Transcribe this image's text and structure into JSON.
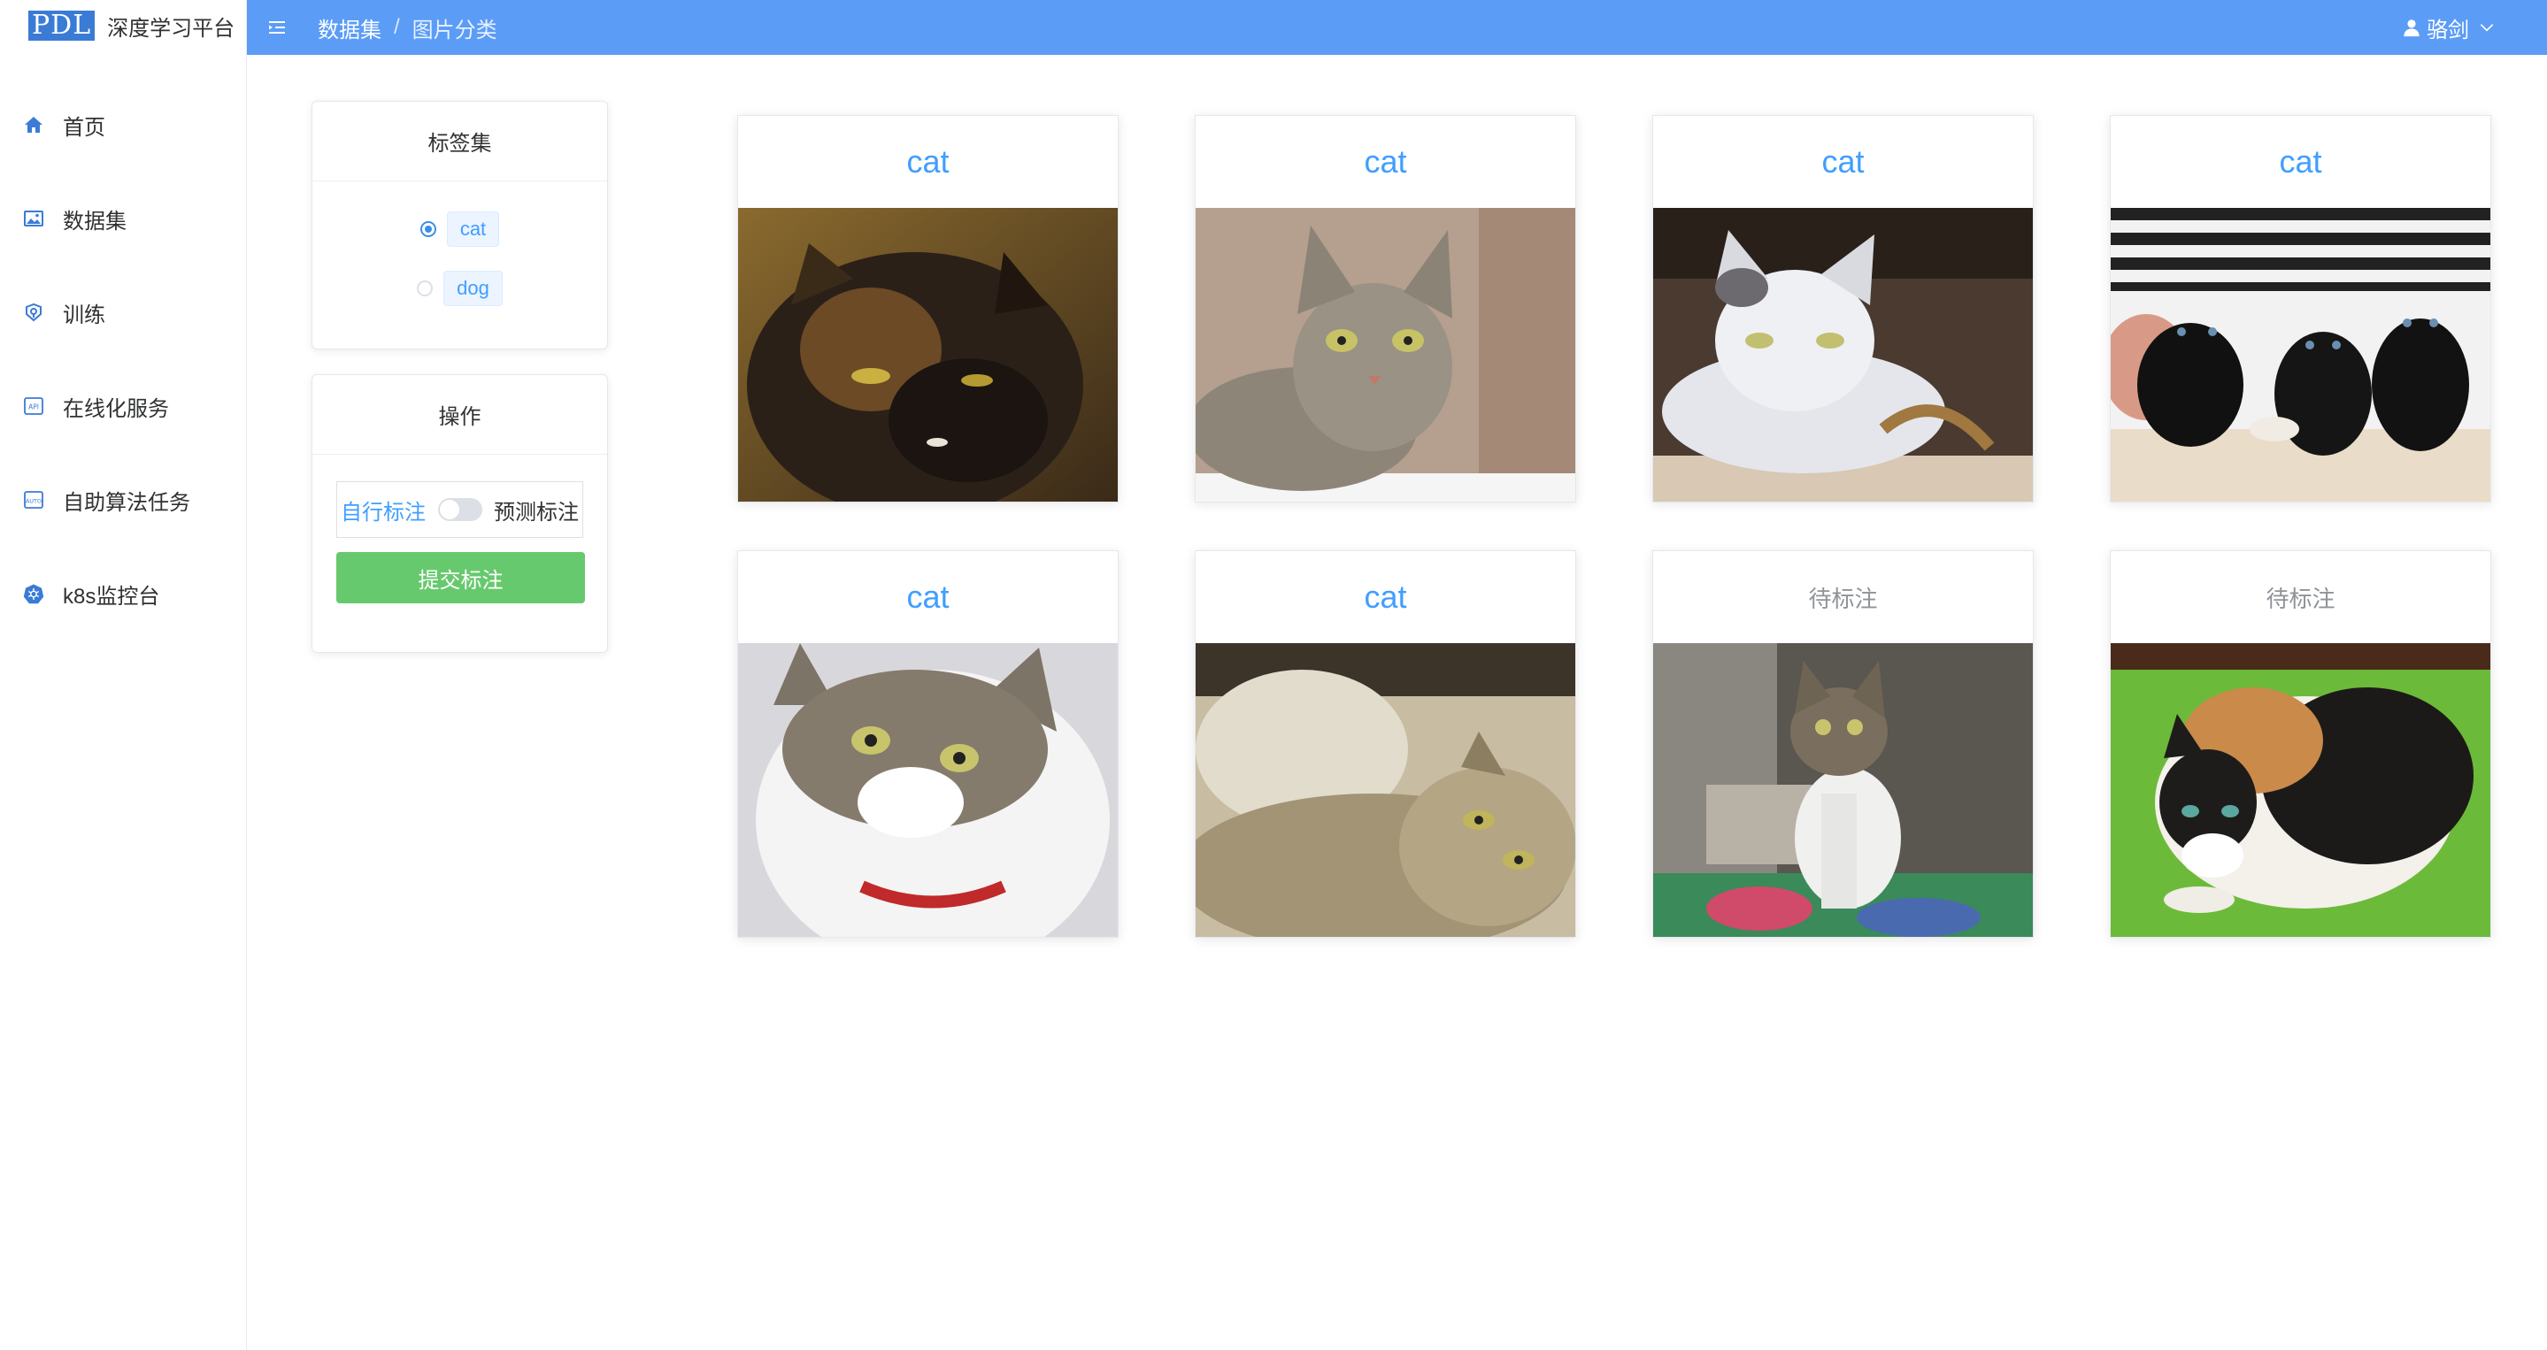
{
  "app": {
    "logo_mark": "PDL",
    "title": "深度学习平台"
  },
  "sidebar": {
    "items": [
      {
        "label": "首页",
        "icon": "home-icon"
      },
      {
        "label": "数据集",
        "icon": "image-icon"
      },
      {
        "label": "训练",
        "icon": "training-icon"
      },
      {
        "label": "在线化服务",
        "icon": "api-icon"
      },
      {
        "label": "自助算法任务",
        "icon": "auto-icon"
      },
      {
        "label": "k8s监控台",
        "icon": "kubernetes-icon"
      }
    ]
  },
  "header": {
    "breadcrumb": [
      "数据集",
      "图片分类"
    ],
    "breadcrumb_sep": "/",
    "user": "骆剑",
    "accent": "#5b9cf7"
  },
  "label_panel": {
    "title": "标签集",
    "options": [
      {
        "label": "cat",
        "selected": true
      },
      {
        "label": "dog",
        "selected": false
      }
    ]
  },
  "action_panel": {
    "title": "操作",
    "switch_left": "自行标注",
    "switch_right": "预测标注",
    "switch_on": false,
    "submit": "提交标注",
    "submit_color": "#67c96e"
  },
  "images": [
    {
      "label": "cat",
      "status": "labeled"
    },
    {
      "label": "cat",
      "status": "labeled"
    },
    {
      "label": "cat",
      "status": "labeled"
    },
    {
      "label": "cat",
      "status": "labeled"
    },
    {
      "label": "cat",
      "status": "labeled"
    },
    {
      "label": "cat",
      "status": "labeled"
    },
    {
      "label": "待标注",
      "status": "pending"
    },
    {
      "label": "待标注",
      "status": "pending"
    }
  ]
}
